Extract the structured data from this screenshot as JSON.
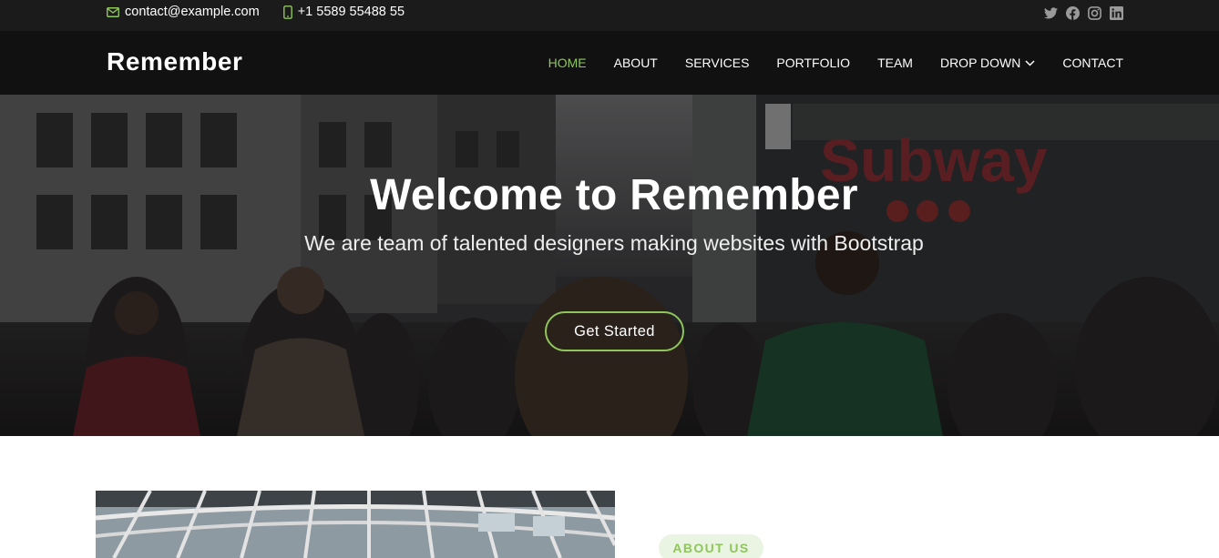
{
  "topbar": {
    "email": "contact@example.com",
    "phone": "+1 5589 55488 55",
    "icons": [
      "envelope-icon",
      "phone-icon",
      "twitter-icon",
      "facebook-icon",
      "instagram-icon",
      "linkedin-icon"
    ]
  },
  "header": {
    "logo": "Remember",
    "nav": [
      {
        "label": "HOME",
        "active": true
      },
      {
        "label": "ABOUT"
      },
      {
        "label": "SERVICES"
      },
      {
        "label": "PORTFOLIO"
      },
      {
        "label": "TEAM"
      },
      {
        "label": "DROP DOWN",
        "dropdown": true
      },
      {
        "label": "CONTACT"
      }
    ]
  },
  "hero": {
    "title": "Welcome to Remember",
    "subtitle": "We are team of talented designers making websites with Bootstrap",
    "cta_label": "Get Started"
  },
  "about": {
    "badge": "ABOUT US"
  },
  "colors": {
    "accent": "#8fc65b",
    "topbar_bg": "#1b1b1b",
    "header_bg": "#111111"
  }
}
